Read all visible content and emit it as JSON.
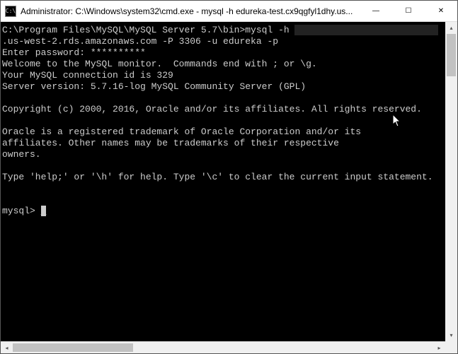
{
  "window": {
    "title": "Administrator: C:\\Windows\\system32\\cmd.exe - mysql  -h edureka-test.cx9qgfyl1dhy.us...",
    "icon_label": "C:\\"
  },
  "terminal": {
    "line1_prefix": "C:\\Program Files\\MySQL\\MySQL Server 5.7\\bin>mysql -h ",
    "line1_blurred": "                          ",
    "line2": ".us-west-2.rds.amazonaws.com -P 3306 -u edureka -p",
    "line3": "Enter password: **********",
    "line4": "Welcome to the MySQL monitor.  Commands end with ; or \\g.",
    "line5": "Your MySQL connection id is 329",
    "line6": "Server version: 5.7.16-log MySQL Community Server (GPL)",
    "line7": "Copyright (c) 2000, 2016, Oracle and/or its affiliates. All rights reserved.",
    "line8": "Oracle is a registered trademark of Oracle Corporation and/or its",
    "line9": "affiliates. Other names may be trademarks of their respective",
    "line10": "owners.",
    "line11": "Type 'help;' or '\\h' for help. Type '\\c' to clear the current input statement.",
    "prompt": "mysql> ",
    "cursor": "_"
  },
  "controls": {
    "minimize": "—",
    "maximize": "☐",
    "close": "✕",
    "scroll_up": "▴",
    "scroll_down": "▾",
    "scroll_left": "◂",
    "scroll_right": "▸"
  }
}
